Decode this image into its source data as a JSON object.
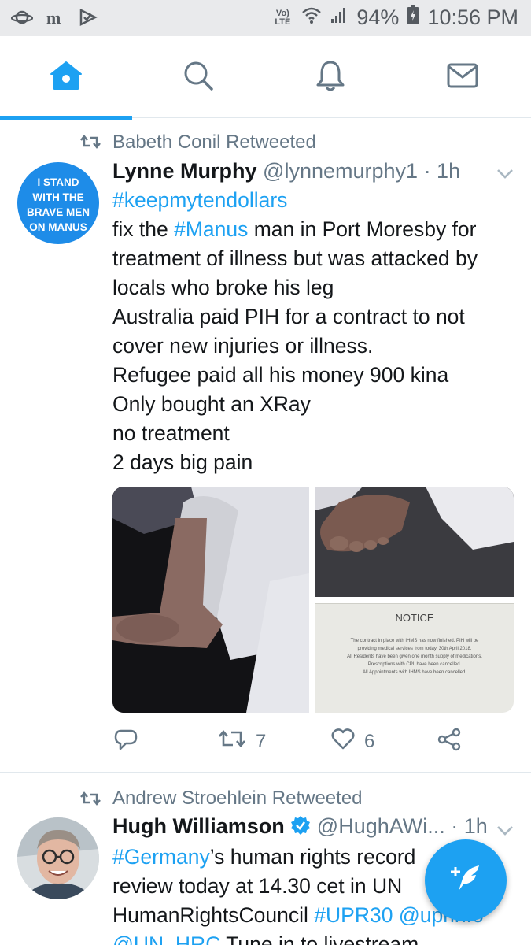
{
  "status_bar": {
    "left_icons": [
      "saturn-icon",
      "m-app-icon",
      "check-flag-icon"
    ],
    "volte_top": "Vo)",
    "volte_bottom": "LTE",
    "battery": "94%",
    "time": "10:56 PM"
  },
  "nav": {
    "tabs": [
      {
        "name": "home",
        "icon": "home-icon",
        "active": true
      },
      {
        "name": "search",
        "icon": "search-icon",
        "active": false
      },
      {
        "name": "notifications",
        "icon": "bell-icon",
        "active": false
      },
      {
        "name": "messages",
        "icon": "mail-icon",
        "active": false
      }
    ],
    "accent_color": "#1da1f2"
  },
  "tweets": [
    {
      "retweeted_by": "Babeth Conil Retweeted",
      "avatar_text": [
        "I STAND",
        "WITH THE",
        "BRAVE MEN",
        "ON MANUS"
      ],
      "name": "Lynne Murphy",
      "handle": "@lynnemurphy1",
      "time": "· 1h",
      "body": {
        "hashtag1": "#keepmytendollars",
        "l2_pre": "fix the ",
        "l2_tag": "#Manus",
        "l2_post": " man in Port Moresby for",
        "l3": "treatment of illness but was attacked by",
        "l4": "locals who broke his leg",
        "l5": "Australia paid PIH for a contract to not",
        "l6": "cover new injuries or illness.",
        "l7": "Refugee paid all his money 900 kina",
        "l8": "Only bought an XRay",
        "l9": "no treatment",
        "l10": "2 days big pain"
      },
      "media": {
        "notice_title": "NOTICE",
        "notice_lines": [
          "The contract in place with IHMS has now finished. PIH will be",
          "providing medical services from today, 30th April 2018.",
          "All Residents have been given one month supply of medications.",
          "Prescriptions with CPL have been cancelled.",
          "All Appointments with IHMS have been cancelled."
        ]
      },
      "actions": {
        "retweets": "7",
        "likes": "6"
      }
    },
    {
      "retweeted_by": "Andrew Stroehlein Retweeted",
      "name": "Hugh Williamson",
      "handle": "@HughAWi...",
      "time": "· 1h",
      "body": {
        "l1_tag": "#Germany",
        "l1_post": "’s human rights record",
        "l2": "review today at 14.30 cet in UN",
        "l3_pre": "HumanRightsCouncil ",
        "l3_tag": "#UPR30",
        "l3_mention": " @uprinfo",
        "l4_mention": "@UN_HRC",
        "l4_post": " Tune in to livestream"
      }
    }
  ]
}
